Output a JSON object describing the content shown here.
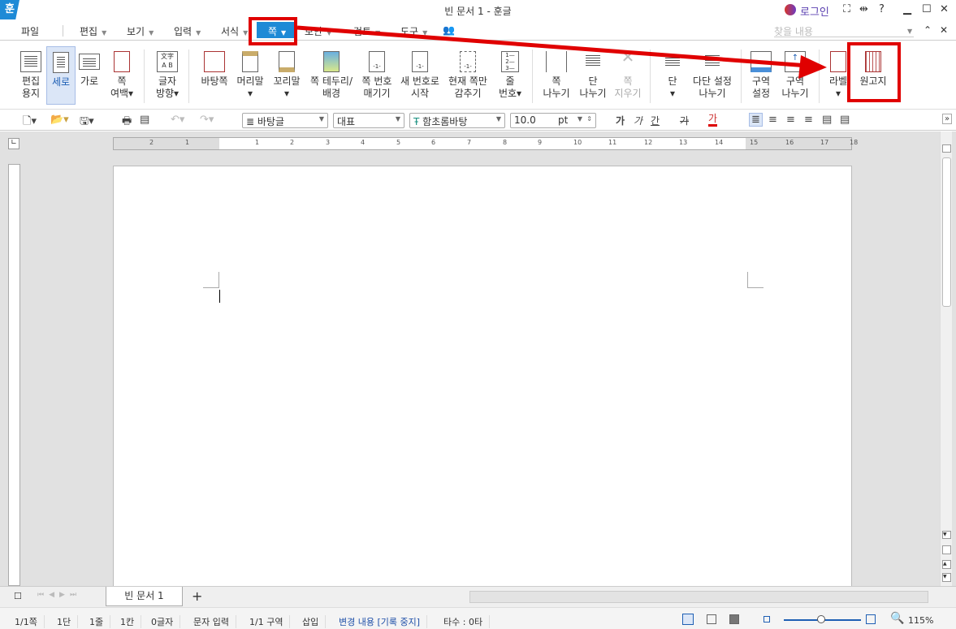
{
  "window": {
    "title": "빈 문서 1 - 훈글",
    "app_logo": "훈",
    "login": "로그인",
    "help": "?"
  },
  "menu": {
    "items": [
      "파일",
      "편집",
      "보기",
      "입력",
      "서식",
      "쪽",
      "보안",
      "검토",
      "도구"
    ],
    "find_placeholder": "찾을 내용"
  },
  "ribbon": {
    "items": [
      {
        "label1": "편집",
        "label2": "용지"
      },
      {
        "label1": "세로",
        "label2": ""
      },
      {
        "label1": "가로",
        "label2": ""
      },
      {
        "label1": "쪽",
        "label2": "여백"
      },
      {
        "label1": "글자",
        "label2": "방향"
      },
      {
        "label1": "바탕쪽",
        "label2": ""
      },
      {
        "label1": "머리말",
        "label2": ""
      },
      {
        "label1": "꼬리말",
        "label2": ""
      },
      {
        "label1": "쪽 테두리/",
        "label2": "배경"
      },
      {
        "label1": "쪽 번호",
        "label2": "매기기"
      },
      {
        "label1": "새 번호로",
        "label2": "시작"
      },
      {
        "label1": "현재 쪽만",
        "label2": "감추기"
      },
      {
        "label1": "줄",
        "label2": "번호"
      },
      {
        "label1": "쪽",
        "label2": "나누기"
      },
      {
        "label1": "단",
        "label2": "나누기"
      },
      {
        "label1": "쪽",
        "label2": "지우기"
      },
      {
        "label1": "단",
        "label2": ""
      },
      {
        "label1": "다단 설정",
        "label2": "나누기"
      },
      {
        "label1": "구역",
        "label2": "설정"
      },
      {
        "label1": "구역",
        "label2": "나누기"
      },
      {
        "label1": "라벨",
        "label2": ""
      },
      {
        "label1": "원고지",
        "label2": ""
      }
    ]
  },
  "toolbar": {
    "style": "바탕글",
    "lang": "대표",
    "font": "함초롬바탕",
    "size": "10.0",
    "unit": "pt",
    "bold": "가",
    "italic": "가",
    "underline": "간",
    "strike": "가",
    "color_char": "가"
  },
  "ruler": {
    "ticks": [
      "2",
      "1",
      "1",
      "2",
      "3",
      "4",
      "5",
      "6",
      "7",
      "8",
      "9",
      "10",
      "11",
      "12",
      "13",
      "14",
      "15",
      "16",
      "17",
      "18"
    ]
  },
  "tabs": {
    "doc": "빈 문서 1",
    "add": "+"
  },
  "status": {
    "page": "1/1쪽",
    "col": "1단",
    "line": "1줄",
    "pos": "1칸",
    "chars": "0글자",
    "mode": "문자 입력",
    "section": "1/1 구역",
    "insert": "삽입",
    "track": "변경 내용 [기록 중지]",
    "typing": "타수 : 0타",
    "zoom": "115%"
  },
  "colors": {
    "accent": "#1e8ad6",
    "annotation": "#e00000",
    "selected": "#dbe6f7"
  }
}
